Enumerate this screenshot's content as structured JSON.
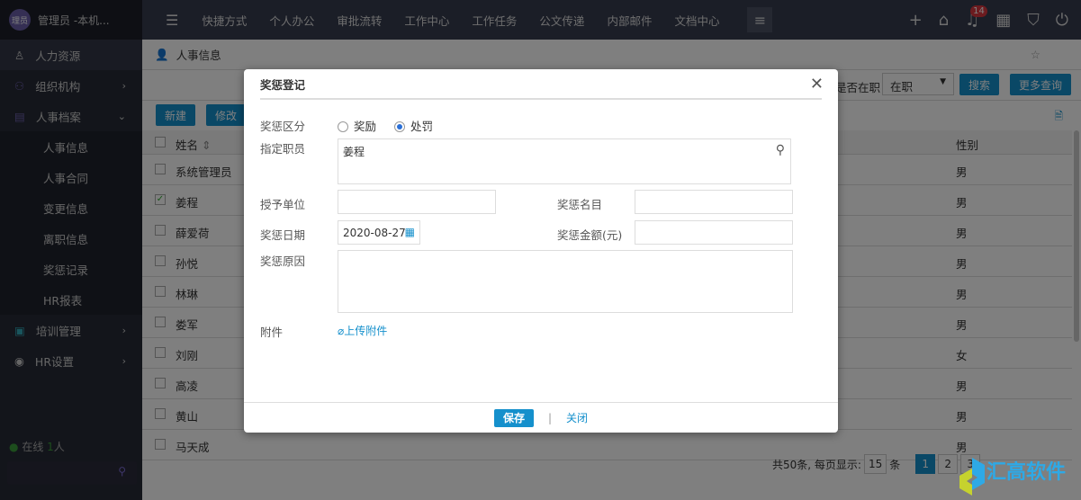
{
  "user": {
    "avatar": "理员",
    "name": "管理员 -本机..."
  },
  "sidebar": {
    "items": [
      {
        "label": "人力资源",
        "icon": "person-list-icon"
      },
      {
        "label": "组织机构",
        "icon": "org-icon"
      },
      {
        "label": "人事档案",
        "icon": "file-person-icon"
      }
    ],
    "sub": [
      "人事信息",
      "人事合同",
      "变更信息",
      "离职信息",
      "奖惩记录",
      "HR报表"
    ],
    "more": [
      {
        "label": "培训管理",
        "icon": "training-icon"
      },
      {
        "label": "HR设置",
        "icon": "hr-icon"
      }
    ],
    "online_label": "在线",
    "online_count": "1",
    "online_unit": "人"
  },
  "topnav": [
    "快捷方式",
    "个人办公",
    "审批流转",
    "工作中心",
    "工作任务",
    "公文传递",
    "内部邮件",
    "文档中心"
  ],
  "notif_count": "14",
  "breadcrumb": "人事信息",
  "search": {
    "label": "是否在职",
    "value": "在职",
    "search": "搜索",
    "more": "更多查询"
  },
  "toolbar": {
    "new": "新建",
    "edit": "修改"
  },
  "table": {
    "headers": {
      "name": "姓名",
      "gender": "性别"
    },
    "rows": [
      {
        "name": "系统管理员",
        "gender": "男",
        "checked": false
      },
      {
        "name": "姜程",
        "gender": "男",
        "checked": true
      },
      {
        "name": "薛爱荷",
        "gender": "男",
        "checked": false
      },
      {
        "name": "孙悦",
        "gender": "男",
        "checked": false
      },
      {
        "name": "林琳",
        "gender": "男",
        "checked": false
      },
      {
        "name": "娄军",
        "gender": "男",
        "checked": false
      },
      {
        "name": "刘刚",
        "gender": "女",
        "checked": false
      },
      {
        "name": "高凌",
        "gender": "男",
        "checked": false
      },
      {
        "name": "黄山",
        "gender": "男",
        "checked": false
      },
      {
        "name": "马天成",
        "gender": "男",
        "checked": false
      }
    ]
  },
  "pager": {
    "total": "共50条, 每页显示:",
    "size": "15",
    "unit": "条",
    "pages": [
      "1",
      "2",
      "3"
    ]
  },
  "logo": {
    "text": "汇高软件"
  },
  "modal": {
    "title": "奖惩登记",
    "type_label": "奖惩区分",
    "reward": "奖励",
    "punish": "处罚",
    "selected": "处罚",
    "employee_label": "指定职员",
    "employee": "姜程",
    "unit_label": "授予单位",
    "unit": "",
    "name_label": "奖惩名目",
    "name": "",
    "date_label": "奖惩日期",
    "date": "2020-08-27",
    "amount_label": "奖惩金额(元)",
    "amount": "",
    "reason_label": "奖惩原因",
    "reason": "",
    "attach_label": "附件",
    "upload": "上传附件",
    "save": "保存",
    "close": "关闭"
  }
}
